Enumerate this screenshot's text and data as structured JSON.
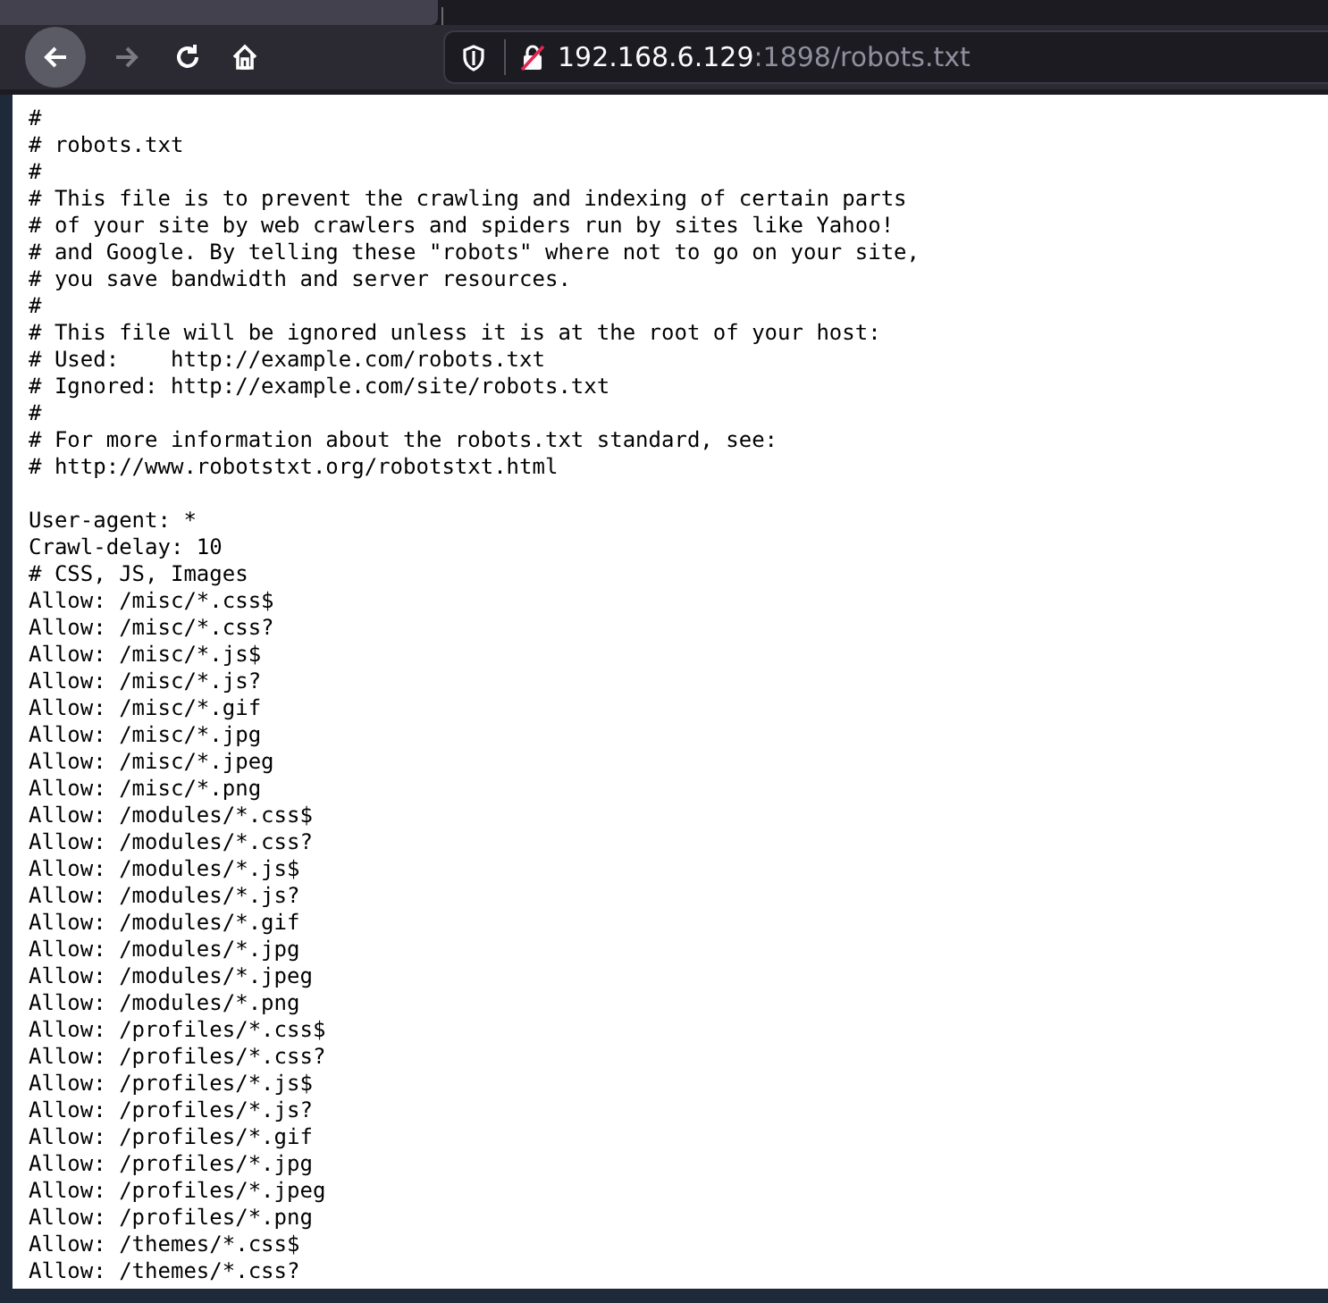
{
  "toolbar": {
    "back": {
      "disabled": false
    },
    "forward": {
      "disabled": true
    },
    "address": {
      "host": "192.168.6.129",
      "rest": ":1898/robots.txt"
    }
  },
  "document": {
    "blocks": [
      [
        "#",
        "# robots.txt",
        "#",
        "# This file is to prevent the crawling and indexing of certain parts",
        "# of your site by web crawlers and spiders run by sites like Yahoo!",
        "# and Google. By telling these \"robots\" where not to go on your site,",
        "# you save bandwidth and server resources.",
        "#",
        "# This file will be ignored unless it is at the root of your host:",
        "# Used:    http://example.com/robots.txt",
        "# Ignored: http://example.com/site/robots.txt",
        "#",
        "# For more information about the robots.txt standard, see:",
        "# http://www.robotstxt.org/robotstxt.html"
      ],
      [
        "User-agent: *",
        "Crawl-delay: 10",
        "# CSS, JS, Images",
        "Allow: /misc/*.css$",
        "Allow: /misc/*.css?",
        "Allow: /misc/*.js$",
        "Allow: /misc/*.js?",
        "Allow: /misc/*.gif",
        "Allow: /misc/*.jpg",
        "Allow: /misc/*.jpeg",
        "Allow: /misc/*.png",
        "Allow: /modules/*.css$",
        "Allow: /modules/*.css?",
        "Allow: /modules/*.js$",
        "Allow: /modules/*.js?",
        "Allow: /modules/*.gif",
        "Allow: /modules/*.jpg",
        "Allow: /modules/*.jpeg",
        "Allow: /modules/*.png",
        "Allow: /profiles/*.css$",
        "Allow: /profiles/*.css?",
        "Allow: /profiles/*.js$",
        "Allow: /profiles/*.js?",
        "Allow: /profiles/*.gif",
        "Allow: /profiles/*.jpg",
        "Allow: /profiles/*.jpeg",
        "Allow: /profiles/*.png",
        "Allow: /themes/*.css$",
        "Allow: /themes/*.css?"
      ]
    ]
  }
}
